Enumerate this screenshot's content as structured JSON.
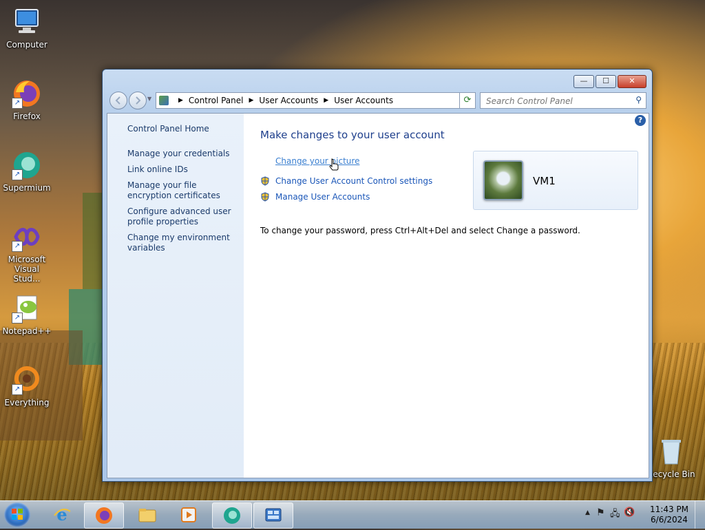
{
  "desktop": {
    "icons": [
      {
        "label": "Computer",
        "icon": "computer-icon"
      },
      {
        "label": "Firefox",
        "icon": "firefox-icon"
      },
      {
        "label": "Supermium",
        "icon": "supermium-icon"
      },
      {
        "label": "Microsoft Visual Stud...",
        "icon": "visual-studio-icon"
      },
      {
        "label": "Notepad++",
        "icon": "notepadpp-icon"
      },
      {
        "label": "Everything",
        "icon": "everything-icon"
      },
      {
        "label": "Recycle Bin",
        "icon": "recycle-bin-icon"
      }
    ]
  },
  "window": {
    "breadcrumb": [
      "Control Panel",
      "User Accounts",
      "User Accounts"
    ],
    "search_placeholder": "Search Control Panel",
    "controls": {
      "minimize": "—",
      "maximize": "☐",
      "close": "✕"
    },
    "sidebar": {
      "home": "Control Panel Home",
      "links": [
        "Manage your credentials",
        "Link online IDs",
        "Manage your file encryption certificates",
        "Configure advanced user profile properties",
        "Change my environment variables"
      ]
    },
    "main": {
      "heading": "Make changes to your user account",
      "tasks": [
        "Change your picture",
        "Change User Account Control settings",
        "Manage User Accounts"
      ],
      "password_note": "To change your password, press Ctrl+Alt+Del and select Change a password.",
      "user_name": "VM1"
    }
  },
  "taskbar": {
    "items": [
      "internet-explorer-icon",
      "firefox-icon",
      "explorer-icon",
      "media-player-icon",
      "supermium-icon",
      "control-panel-icon"
    ],
    "clock_time": "11:43 PM",
    "clock_date": "6/6/2024"
  }
}
